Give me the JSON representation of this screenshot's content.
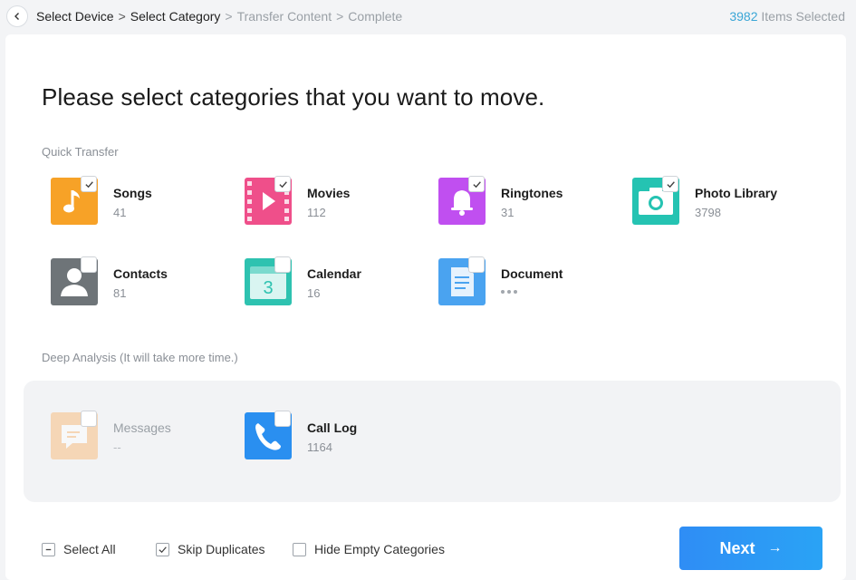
{
  "breadcrumb": {
    "steps": [
      "Select Device",
      "Select Category",
      "Transfer Content",
      "Complete"
    ],
    "separator": ">"
  },
  "status": {
    "count": "3982",
    "label": "Items Selected"
  },
  "headline": "Please select categories that you want to move.",
  "quick_transfer": {
    "label": "Quick Transfer",
    "items": [
      {
        "name": "Songs",
        "count": "41",
        "checked": true,
        "icon": "music-note-icon",
        "color": "#f7a227"
      },
      {
        "name": "Movies",
        "count": "112",
        "checked": true,
        "icon": "film-play-icon",
        "color": "#ef4f8a"
      },
      {
        "name": "Ringtones",
        "count": "31",
        "checked": true,
        "icon": "bell-icon",
        "color": "#c04ff0"
      },
      {
        "name": "Photo Library",
        "count": "3798",
        "checked": true,
        "icon": "camera-icon",
        "color": "#25c3b2"
      },
      {
        "name": "Contacts",
        "count": "81",
        "checked": false,
        "icon": "contact-person-icon",
        "color": "#6e7478"
      },
      {
        "name": "Calendar",
        "count": "16",
        "checked": false,
        "icon": "calendar-icon",
        "color": "#2ec2b0"
      },
      {
        "name": "Document",
        "count": "",
        "checked": false,
        "icon": "document-icon",
        "color": "#4aa3f0"
      }
    ]
  },
  "deep_analysis": {
    "label": "Deep Analysis (It will take more time.)",
    "items": [
      {
        "name": "Messages",
        "count": "--",
        "checked": false,
        "icon": "message-bubble-icon",
        "color": "#f9b56b",
        "disabled": true
      },
      {
        "name": "Call Log",
        "count": "1164",
        "checked": false,
        "icon": "phone-icon",
        "color": "#2a8ff0"
      }
    ]
  },
  "options": {
    "select_all": "Select All",
    "skip_duplicates": "Skip Duplicates",
    "hide_empty": "Hide Empty Categories"
  },
  "next_label": "Next",
  "next_arrow": "→"
}
